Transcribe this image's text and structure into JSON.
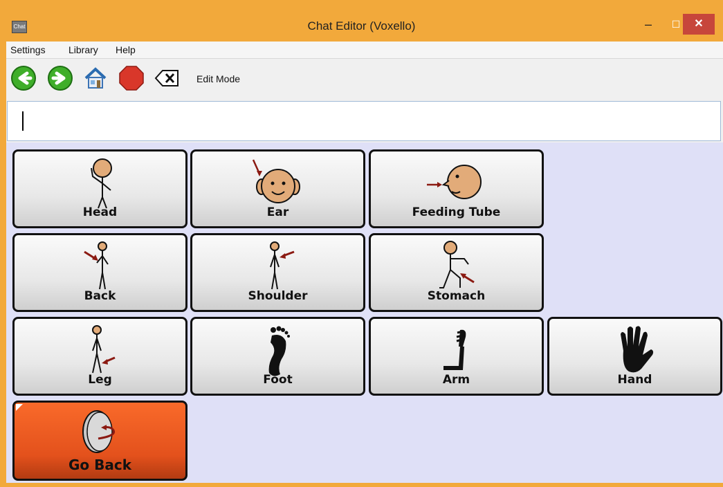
{
  "window": {
    "title": "Chat Editor (Voxello)",
    "icon_text": "Chat",
    "minimize_glyph": "–",
    "maximize_glyph": "☐",
    "close_glyph": "✕"
  },
  "menu": [
    "Settings",
    "Library",
    "Help"
  ],
  "toolbar": {
    "back_icon": "green-back-arrow",
    "forward_icon": "green-forward-arrow",
    "home_icon": "house",
    "stop_icon": "red-stop-octagon",
    "clear_icon": "backspace-x",
    "edit_mode_label": "Edit Mode"
  },
  "message_box": {
    "value": ""
  },
  "tiles": [
    {
      "label": "Head",
      "icon": "head-person-icon"
    },
    {
      "label": "Ear",
      "icon": "ear-face-icon"
    },
    {
      "label": "Feeding Tube",
      "icon": "feeding-tube-face-icon"
    },
    {
      "label": "Back",
      "icon": "back-person-icon"
    },
    {
      "label": "Shoulder",
      "icon": "shoulder-person-icon"
    },
    {
      "label": "Stomach",
      "icon": "stomach-person-icon"
    },
    {
      "label": "Leg",
      "icon": "leg-person-icon"
    },
    {
      "label": "Foot",
      "icon": "foot-icon"
    },
    {
      "label": "Arm",
      "icon": "arm-icon"
    },
    {
      "label": "Hand",
      "icon": "hand-icon"
    },
    {
      "label": "Go Back",
      "icon": "go-back-icon"
    }
  ],
  "colors": {
    "title_bar": "#f2a93b",
    "grid_background": "#dfe0f7",
    "go_back_tile": "#e3511c",
    "close_button": "#c7463b"
  }
}
